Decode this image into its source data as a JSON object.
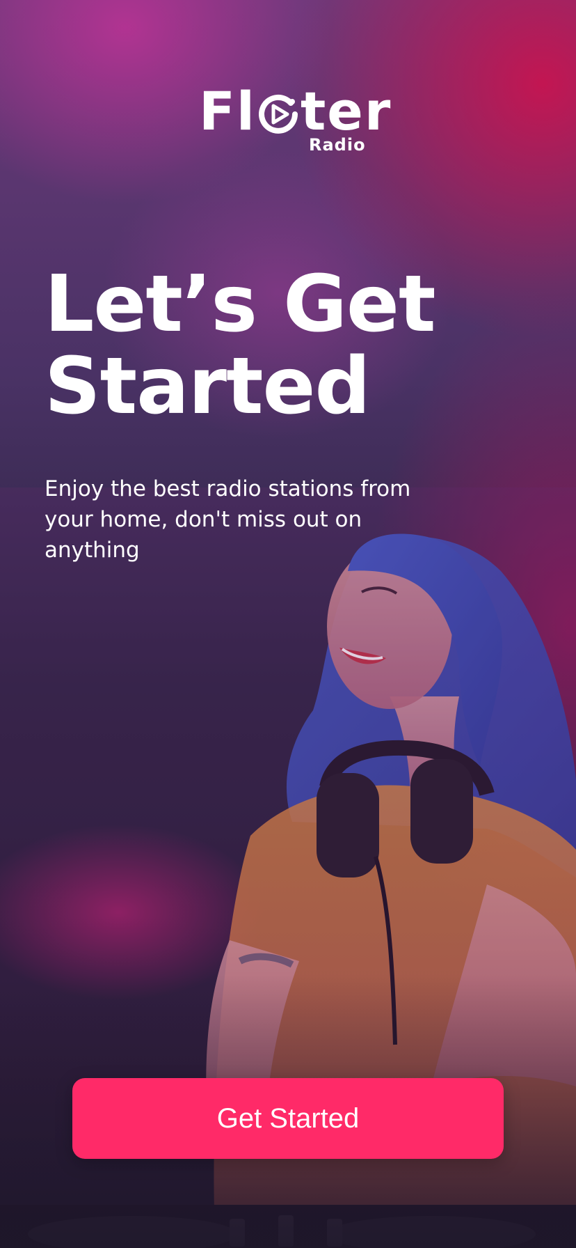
{
  "brand": {
    "name_start": "Fl",
    "name_end": "ter",
    "subtitle": "Radio",
    "logo_icon": "play-circle-icon"
  },
  "onboarding": {
    "title_line1": "Let’s Get",
    "title_line2": "Started",
    "description": "Enjoy the best radio stations from your home, don't miss out on anything",
    "hero_image": "dj-with-headphones-illustration"
  },
  "actions": {
    "get_started_label": "Get Started"
  },
  "colors": {
    "accent": "#ff2a68",
    "text": "#ffffff"
  }
}
